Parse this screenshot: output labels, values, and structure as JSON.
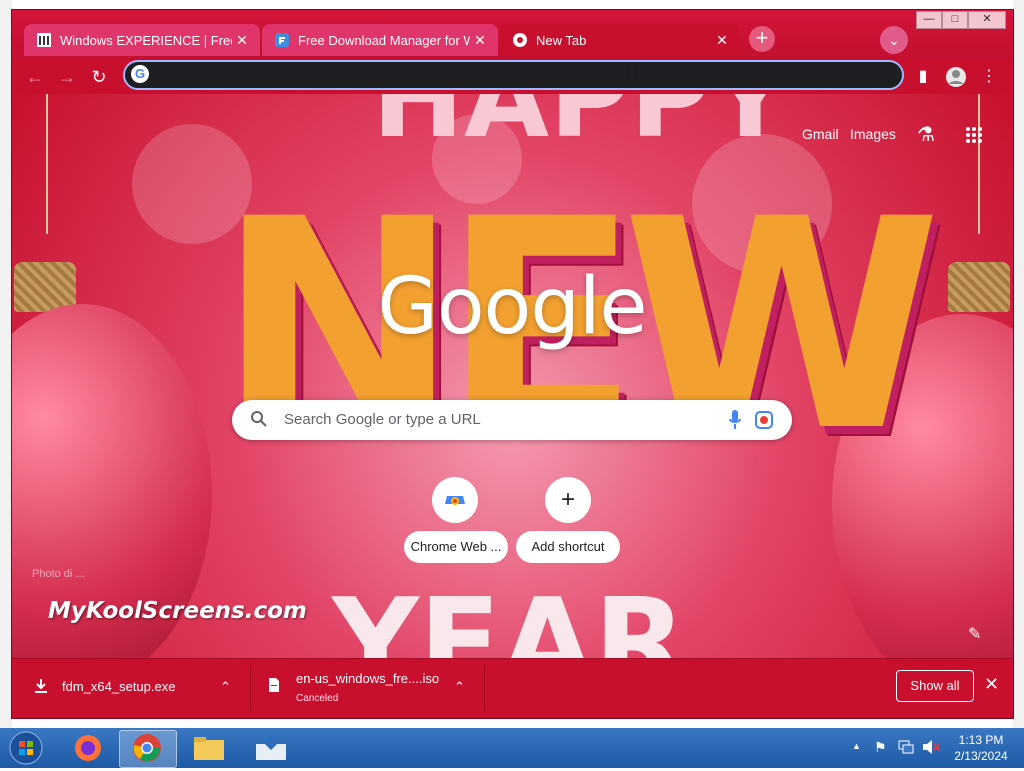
{
  "browser": {
    "tabs": [
      {
        "label": "Windows EXPERIENCE | Freestyle",
        "favicon": "museum-icon",
        "active": false
      },
      {
        "label": "Free Download Manager for Win",
        "favicon": "fdm-icon",
        "active": false
      },
      {
        "label": "New Tab",
        "favicon": "chrome-icon",
        "active": true
      }
    ],
    "tab_close_glyph": "✕",
    "new_tab_glyph": "+",
    "tab_search_glyph": "⌄",
    "window_controls": {
      "minimize": "—",
      "maximize": "□",
      "close": "✕"
    },
    "nav": {
      "back": "←",
      "forward": "→",
      "reload": "↻"
    },
    "omnibox": {
      "value": "",
      "icon": "google-g-icon",
      "icon_glyph": "G"
    },
    "toolbar_icons": {
      "side_panel": "▮",
      "profile": "●",
      "menu": "⋮"
    }
  },
  "newtab": {
    "top_links": {
      "gmail": "Gmail",
      "images": "Images"
    },
    "labs_icon": "⚗",
    "apps_icon": "⁝⁝⁝",
    "logo_text": "Google",
    "search": {
      "placeholder": "Search Google or type a URL",
      "icon": "⚲"
    },
    "shortcuts": [
      {
        "label": "Chrome Web ...",
        "icon": "chrome-web-store-icon"
      },
      {
        "label": "Add shortcut",
        "icon": "plus-icon",
        "glyph": "+"
      }
    ],
    "background_words": {
      "top": "HAPPY",
      "middle": "NEW",
      "bottom": "YEAR"
    },
    "photo_credit": "Photo di ...",
    "watermark": "MyKoolScreens.com",
    "edit_icon": "✎"
  },
  "downloads": {
    "items": [
      {
        "name": "fdm_x64_setup.exe",
        "status": ""
      },
      {
        "name": "en-us_windows_fre....iso",
        "status": "Canceled"
      }
    ],
    "chevron": "⌃",
    "show_all": "Show all",
    "close": "✕"
  },
  "taskbar": {
    "clock_time": "1:13 PM",
    "clock_date": "2/13/2024",
    "tray_arrow": "▲",
    "flag_icon": "⚑",
    "apps": [
      "start-orb",
      "firefox",
      "chrome",
      "file-explorer",
      "downloads-folder"
    ]
  },
  "colors": {
    "theme": "#c8102e",
    "tab_inactive": "#e0356a",
    "omnibox_bg": "#1e1f22",
    "taskbar": "#2a6cbc"
  }
}
